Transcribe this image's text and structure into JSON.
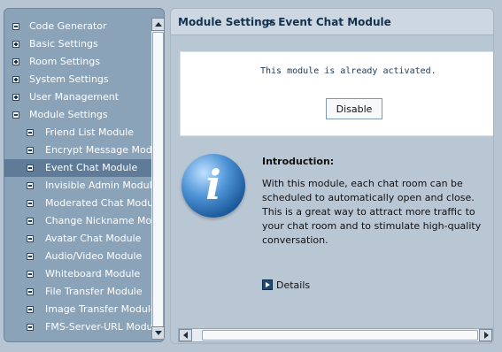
{
  "sidebar": {
    "items": [
      {
        "label": "Code Generator",
        "level": 0,
        "toggle": "minus",
        "selected": false
      },
      {
        "label": "Basic Settings",
        "level": 0,
        "toggle": "plus",
        "selected": false
      },
      {
        "label": "Room Settings",
        "level": 0,
        "toggle": "plus",
        "selected": false
      },
      {
        "label": "System Settings",
        "level": 0,
        "toggle": "plus",
        "selected": false
      },
      {
        "label": "User Management",
        "level": 0,
        "toggle": "plus",
        "selected": false
      },
      {
        "label": "Module Settings",
        "level": 0,
        "toggle": "minus",
        "selected": false
      },
      {
        "label": "Friend List Module",
        "level": 1,
        "toggle": "minus",
        "selected": false
      },
      {
        "label": "Encrypt Message Module",
        "level": 1,
        "toggle": "minus",
        "selected": false
      },
      {
        "label": "Event Chat Module",
        "level": 1,
        "toggle": "minus",
        "selected": true
      },
      {
        "label": "Invisible Admin Module",
        "level": 1,
        "toggle": "minus",
        "selected": false
      },
      {
        "label": "Moderated Chat Module",
        "level": 1,
        "toggle": "minus",
        "selected": false
      },
      {
        "label": "Change Nickname Module",
        "level": 1,
        "toggle": "minus",
        "selected": false
      },
      {
        "label": "Avatar Chat Module",
        "level": 1,
        "toggle": "minus",
        "selected": false
      },
      {
        "label": "Audio/Video Module",
        "level": 1,
        "toggle": "minus",
        "selected": false
      },
      {
        "label": "Whiteboard Module",
        "level": 1,
        "toggle": "minus",
        "selected": false
      },
      {
        "label": "File Transfer Module",
        "level": 1,
        "toggle": "minus",
        "selected": false
      },
      {
        "label": "Image Transfer Module",
        "level": 1,
        "toggle": "minus",
        "selected": false
      },
      {
        "label": "FMS-Server-URL Module",
        "level": 1,
        "toggle": "minus",
        "selected": false
      }
    ]
  },
  "header": {
    "title": "Module Settings",
    "subtitle": "> Event Chat Module"
  },
  "notice": {
    "text": "This module is already activated.",
    "button_label": "Disable"
  },
  "intro": {
    "icon": "info-icon",
    "glyph": "i",
    "heading": "Introduction:",
    "body": "With this module, each chat room can be scheduled to automatically open and close. This is a great way to attract more traffic to your chat room and to stimulate high-quality conversation."
  },
  "details": {
    "icon": "play-arrow-icon",
    "label": "Details"
  },
  "colors": {
    "sidebar_bg": "#8ba3b9",
    "selected_row": "#5f7b98",
    "main_bg": "#b9c6d4",
    "header_text": "#15324f"
  }
}
